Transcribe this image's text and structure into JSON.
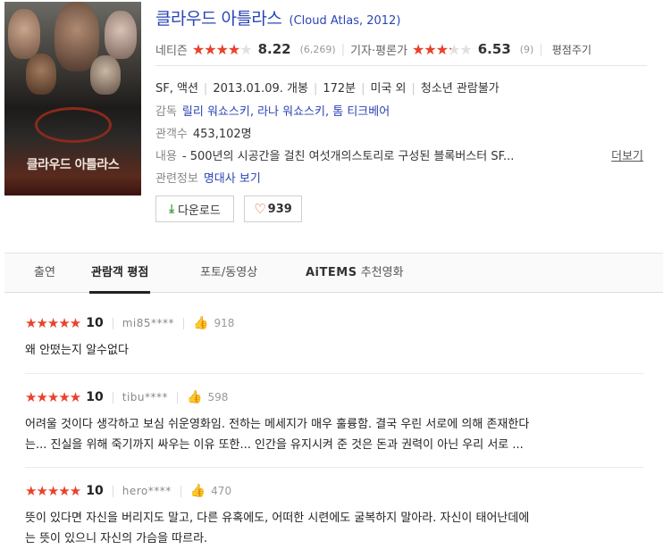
{
  "movie": {
    "title": "클라우드 아틀라스",
    "original": "(Cloud Atlas, 2012)",
    "poster": {
      "title": "클라우드 아틀라스",
      "tagline": "",
      "date": ""
    },
    "netizen": {
      "label": "네티즌",
      "score": "8.22",
      "count": "(6,269)",
      "fraction": 0.822
    },
    "critic": {
      "label": "기자·평론가",
      "score": "6.53",
      "count": "(9)",
      "fraction": 0.653
    },
    "rate_link": "평점주기",
    "genre": "SF, 액션",
    "release": "2013.01.09. 개봉",
    "runtime": "172분",
    "country": "미국 외",
    "grade": "청소년 관람불가",
    "director_label": "감독",
    "directors": "릴리 워쇼스키, 라나 워쇼스키, 톰 티크베어",
    "audience_label": "관객수",
    "audience": "453,102명",
    "content_label": "내용",
    "content": "- 500년의 시공간을 걸친 여섯개의스토리로 구성된 블록버스터 SF...",
    "more": "더보기",
    "related_label": "관련정보",
    "related_link": "명대사 보기",
    "download": "다운로드",
    "likes": "939"
  },
  "tabs": [
    "출연",
    "관람객 평점",
    "포토/동영상",
    "AiTEMS",
    "추천영화"
  ],
  "reviews": [
    {
      "stars": "★★★★★",
      "score": "10",
      "user": "mi85****",
      "likes": "918",
      "text": [
        "왜 안떴는지 알수없다"
      ]
    },
    {
      "stars": "★★★★★",
      "score": "10",
      "user": "tibu****",
      "likes": "598",
      "text": [
        "어려울 것이다 생각하고 보심 쉬운영화임. 전하는 메세지가 매우 훌륭함. 결국 우린 서로에 의해 존재한다",
        "는... 진실을 위해 죽기까지 싸우는 이유 또한... 인간을 유지시켜 준 것은 돈과 권력이 아닌 우리 서로 ..."
      ]
    },
    {
      "stars": "★★★★★",
      "score": "10",
      "user": "hero****",
      "likes": "470",
      "text": [
        "뜻이 있다면 자신을 버리지도 말고, 다른 유혹에도, 어떠한 시련에도 굴복하지 말아라. 자신이 태어난데에",
        "는 뜻이 있으니 자신의 가슴을 따르라."
      ]
    }
  ]
}
